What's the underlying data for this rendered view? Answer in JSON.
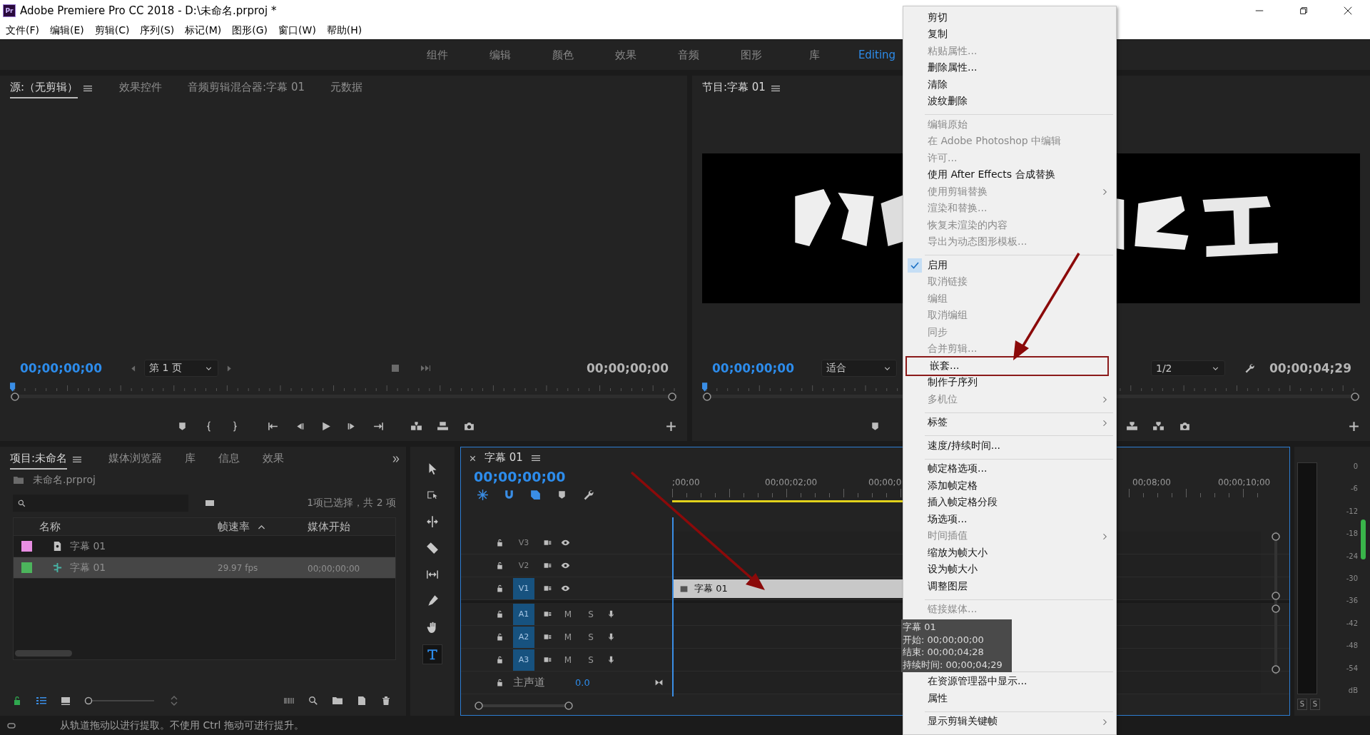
{
  "window": {
    "logo": "Pr",
    "title": "Adobe Premiere Pro CC 2018 - D:\\未命名.prproj *"
  },
  "menu_bar": [
    "文件(F)",
    "编辑(E)",
    "剪辑(C)",
    "序列(S)",
    "标记(M)",
    "图形(G)",
    "窗口(W)",
    "帮助(H)"
  ],
  "workspaces": [
    {
      "label": "组件",
      "selected": false
    },
    {
      "label": "编辑",
      "selected": false
    },
    {
      "label": "颜色",
      "selected": false
    },
    {
      "label": "效果",
      "selected": false
    },
    {
      "label": "音频",
      "selected": false
    },
    {
      "label": "图形",
      "selected": false
    },
    {
      "label": "库",
      "selected": false
    },
    {
      "label": "Editing",
      "selected": true
    }
  ],
  "source_panel": {
    "tabs": [
      {
        "label": "源:（无剪辑）",
        "selected": true
      },
      {
        "label": "效果控件",
        "selected": false
      },
      {
        "label": "音频剪辑混合器:字幕 01",
        "selected": false
      },
      {
        "label": "元数据",
        "selected": false
      }
    ],
    "playhead_timecode": "00;00;00;00",
    "page": "第 1 页",
    "duration": "00;00;00;00"
  },
  "program_panel": {
    "tab": "节目:字幕 01",
    "playhead_timecode": "00;00;00;00",
    "zoom": "适合",
    "resolution": "1/2",
    "duration": "00;00;04;29"
  },
  "project_panel": {
    "tabs": [
      {
        "label": "项目:未命名",
        "selected": true
      },
      {
        "label": "媒体浏览器",
        "selected": false
      },
      {
        "label": "库",
        "selected": false
      },
      {
        "label": "信息",
        "selected": false
      },
      {
        "label": "效果",
        "selected": false
      }
    ],
    "project_file": "未命名.prproj",
    "zoom_slider": {
      "level": 0
    },
    "selection_info": "1项已选择，共 2 项",
    "columns": [
      "名称",
      "帧速率",
      "媒体开始"
    ],
    "rows": [
      {
        "kind": "title",
        "color": "#e88ee3",
        "name": "字幕 01",
        "selected": false
      },
      {
        "kind": "sequence",
        "color": "#4cb45c",
        "name": "字幕 01",
        "frame_rate": "29.97 fps",
        "media_start": "00;00;00;00",
        "selected": true
      }
    ]
  },
  "tools": [
    {
      "selected": false
    },
    {
      "selected": false
    },
    {
      "selected": false
    },
    {
      "selected": false
    },
    {
      "selected": false
    },
    {
      "selected": false
    },
    {
      "selected": false
    },
    {
      "selected": true
    }
  ],
  "timeline": {
    "tab": "字幕 01",
    "timecode": "00;00;00;00",
    "ruler": [
      ";00;00",
      "00;00;02;00",
      "00;00;0",
      "00;08;00",
      "00;00;10;00"
    ],
    "video_tracks": [
      {
        "label": "V3",
        "targeted": false
      },
      {
        "label": "V2",
        "targeted": false
      },
      {
        "label": "V1",
        "targeted": true,
        "clip": "字幕 01"
      }
    ],
    "audio_tracks": [
      {
        "label": "A1",
        "targeted": true,
        "mute": "M",
        "solo": "S"
      },
      {
        "label": "A2",
        "targeted": true,
        "mute": "M",
        "solo": "S"
      },
      {
        "label": "A3",
        "targeted": true,
        "mute": "M",
        "solo": "S"
      }
    ],
    "master": {
      "label": "主声道",
      "value": "0.0"
    }
  },
  "meter": {
    "scale": [
      "0",
      "-6",
      "-12",
      "-18",
      "-24",
      "-30",
      "-36",
      "-42",
      "-48",
      "-54",
      "dB"
    ],
    "solo_buttons": [
      "S",
      "S"
    ]
  },
  "context_menu": {
    "groups": [
      [
        {
          "label": "剪切",
          "disabled": false,
          "checked": false,
          "submenu": false,
          "highlighted": false
        },
        {
          "label": "复制",
          "disabled": false,
          "checked": false,
          "submenu": false,
          "highlighted": false
        },
        {
          "label": "粘贴属性...",
          "disabled": true,
          "checked": false,
          "submenu": false,
          "highlighted": false
        },
        {
          "label": "删除属性...",
          "disabled": false,
          "checked": false,
          "submenu": false,
          "highlighted": false
        },
        {
          "label": "清除",
          "disabled": false,
          "checked": false,
          "submenu": false,
          "highlighted": false
        },
        {
          "label": "波纹删除",
          "disabled": false,
          "checked": false,
          "submenu": false,
          "highlighted": false
        }
      ],
      [
        {
          "label": "编辑原始",
          "disabled": true,
          "checked": false,
          "submenu": false,
          "highlighted": false
        },
        {
          "label": "在 Adobe Photoshop 中编辑",
          "disabled": true,
          "checked": false,
          "submenu": false,
          "highlighted": false
        },
        {
          "label": "许可...",
          "disabled": true,
          "checked": false,
          "submenu": false,
          "highlighted": false
        },
        {
          "label": "使用 After Effects 合成替换",
          "disabled": false,
          "checked": false,
          "submenu": false,
          "highlighted": false
        },
        {
          "label": "使用剪辑替换",
          "disabled": true,
          "checked": false,
          "submenu": true,
          "highlighted": false
        },
        {
          "label": "渲染和替换...",
          "disabled": true,
          "checked": false,
          "submenu": false,
          "highlighted": false
        },
        {
          "label": "恢复未渲染的内容",
          "disabled": true,
          "checked": false,
          "submenu": false,
          "highlighted": false
        },
        {
          "label": "导出为动态图形模板...",
          "disabled": true,
          "checked": false,
          "submenu": false,
          "highlighted": false
        }
      ],
      [
        {
          "label": "启用",
          "disabled": false,
          "checked": true,
          "submenu": false,
          "highlighted": false
        },
        {
          "label": "取消链接",
          "disabled": true,
          "checked": false,
          "submenu": false,
          "highlighted": false
        },
        {
          "label": "编组",
          "disabled": true,
          "checked": false,
          "submenu": false,
          "highlighted": false
        },
        {
          "label": "取消编组",
          "disabled": true,
          "checked": false,
          "submenu": false,
          "highlighted": false
        },
        {
          "label": "同步",
          "disabled": true,
          "checked": false,
          "submenu": false,
          "highlighted": false
        },
        {
          "label": "合并剪辑...",
          "disabled": true,
          "checked": false,
          "submenu": false,
          "highlighted": false
        },
        {
          "label": "嵌套...",
          "disabled": false,
          "checked": false,
          "submenu": false,
          "highlighted": true
        },
        {
          "label": "制作子序列",
          "disabled": false,
          "checked": false,
          "submenu": false,
          "highlighted": false
        },
        {
          "label": "多机位",
          "disabled": true,
          "checked": false,
          "submenu": true,
          "highlighted": false
        }
      ],
      [
        {
          "label": "标签",
          "disabled": false,
          "checked": false,
          "submenu": true,
          "highlighted": false
        }
      ],
      [
        {
          "label": "速度/持续时间...",
          "disabled": false,
          "checked": false,
          "submenu": false,
          "highlighted": false
        }
      ],
      [
        {
          "label": "帧定格选项...",
          "disabled": false,
          "checked": false,
          "submenu": false,
          "highlighted": false
        },
        {
          "label": "添加帧定格",
          "disabled": false,
          "checked": false,
          "submenu": false,
          "highlighted": false
        },
        {
          "label": "插入帧定格分段",
          "disabled": false,
          "checked": false,
          "submenu": false,
          "highlighted": false
        },
        {
          "label": "场选项...",
          "disabled": false,
          "checked": false,
          "submenu": false,
          "highlighted": false
        },
        {
          "label": "时间插值",
          "disabled": true,
          "checked": false,
          "submenu": true,
          "highlighted": false
        },
        {
          "label": "缩放为帧大小",
          "disabled": false,
          "checked": false,
          "submenu": false,
          "highlighted": false
        },
        {
          "label": "设为帧大小",
          "disabled": false,
          "checked": false,
          "submenu": false,
          "highlighted": false
        },
        {
          "label": "调整图层",
          "disabled": false,
          "checked": false,
          "submenu": false,
          "highlighted": false
        }
      ],
      [
        {
          "label": "链接媒体...",
          "disabled": true,
          "checked": false,
          "submenu": false,
          "highlighted": false
        }
      ],
      [
        {
          "label": "在资源管理器中显示...",
          "disabled": false,
          "checked": false,
          "submenu": false,
          "highlighted": false
        },
        {
          "label": "属性",
          "disabled": false,
          "checked": false,
          "submenu": false,
          "highlighted": false
        }
      ],
      [
        {
          "label": "显示剪辑关键帧",
          "disabled": false,
          "checked": false,
          "submenu": true,
          "highlighted": false
        }
      ]
    ]
  },
  "tooltip": [
    "字幕 01",
    "开始: 00;00;00;00",
    "结束: 00;00;04;28",
    "持续时间: 00;00;04;29"
  ],
  "status_bar": "从轨道拖动以进行提取。不使用 Ctrl 拖动可进行提升。"
}
